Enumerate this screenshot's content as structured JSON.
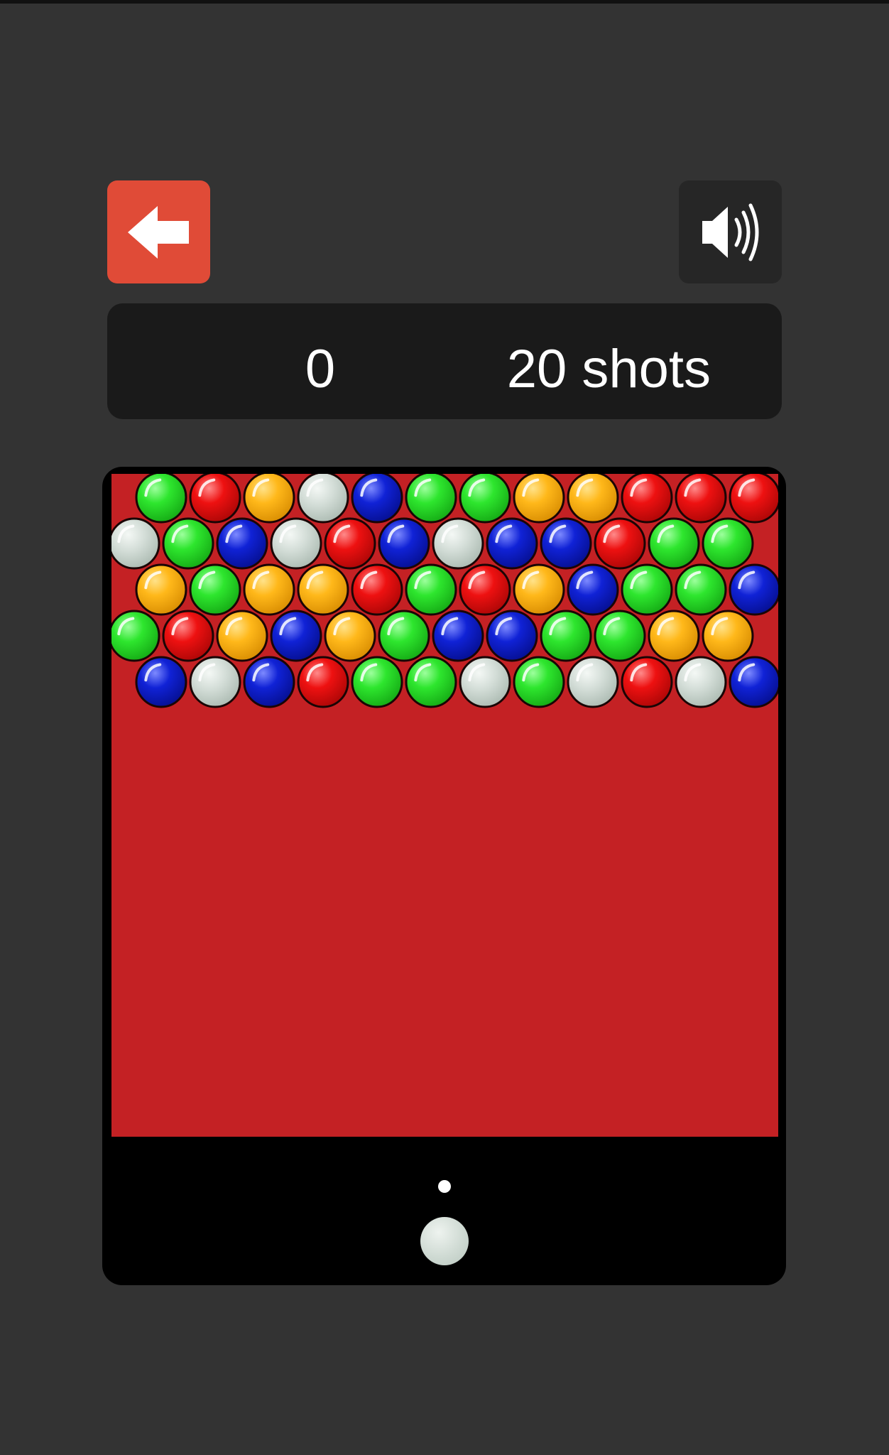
{
  "header": {
    "back_icon": "arrow-left-icon",
    "sound_icon": "speaker-volume-icon"
  },
  "score_panel": {
    "score": "0",
    "shots": "20 shots"
  },
  "colors": {
    "background": "#333333",
    "back_button": "#e04b37",
    "play_area": "#c42124",
    "green": "#2ee62e",
    "red": "#ee1111",
    "yellow": "#ffb81a",
    "white": "#d3ddd7",
    "blue": "#1022d6"
  },
  "bubble_grid": {
    "rows": [
      [
        "green",
        "red",
        "yellow",
        "white",
        "blue",
        "green",
        "green",
        "yellow",
        "yellow",
        "red",
        "red",
        "red"
      ],
      [
        "white",
        "green",
        "blue",
        "white",
        "red",
        "blue",
        "white",
        "blue",
        "blue",
        "red",
        "green",
        "green"
      ],
      [
        "yellow",
        "green",
        "yellow",
        "yellow",
        "red",
        "green",
        "red",
        "yellow",
        "blue",
        "green",
        "green",
        "blue"
      ],
      [
        "green",
        "red",
        "yellow",
        "blue",
        "yellow",
        "green",
        "blue",
        "blue",
        "green",
        "green",
        "yellow",
        "yellow"
      ],
      [
        "blue",
        "white",
        "blue",
        "red",
        "green",
        "green",
        "white",
        "green",
        "white",
        "red",
        "white",
        "blue"
      ]
    ]
  },
  "launcher": {
    "current_bubble": "white"
  }
}
